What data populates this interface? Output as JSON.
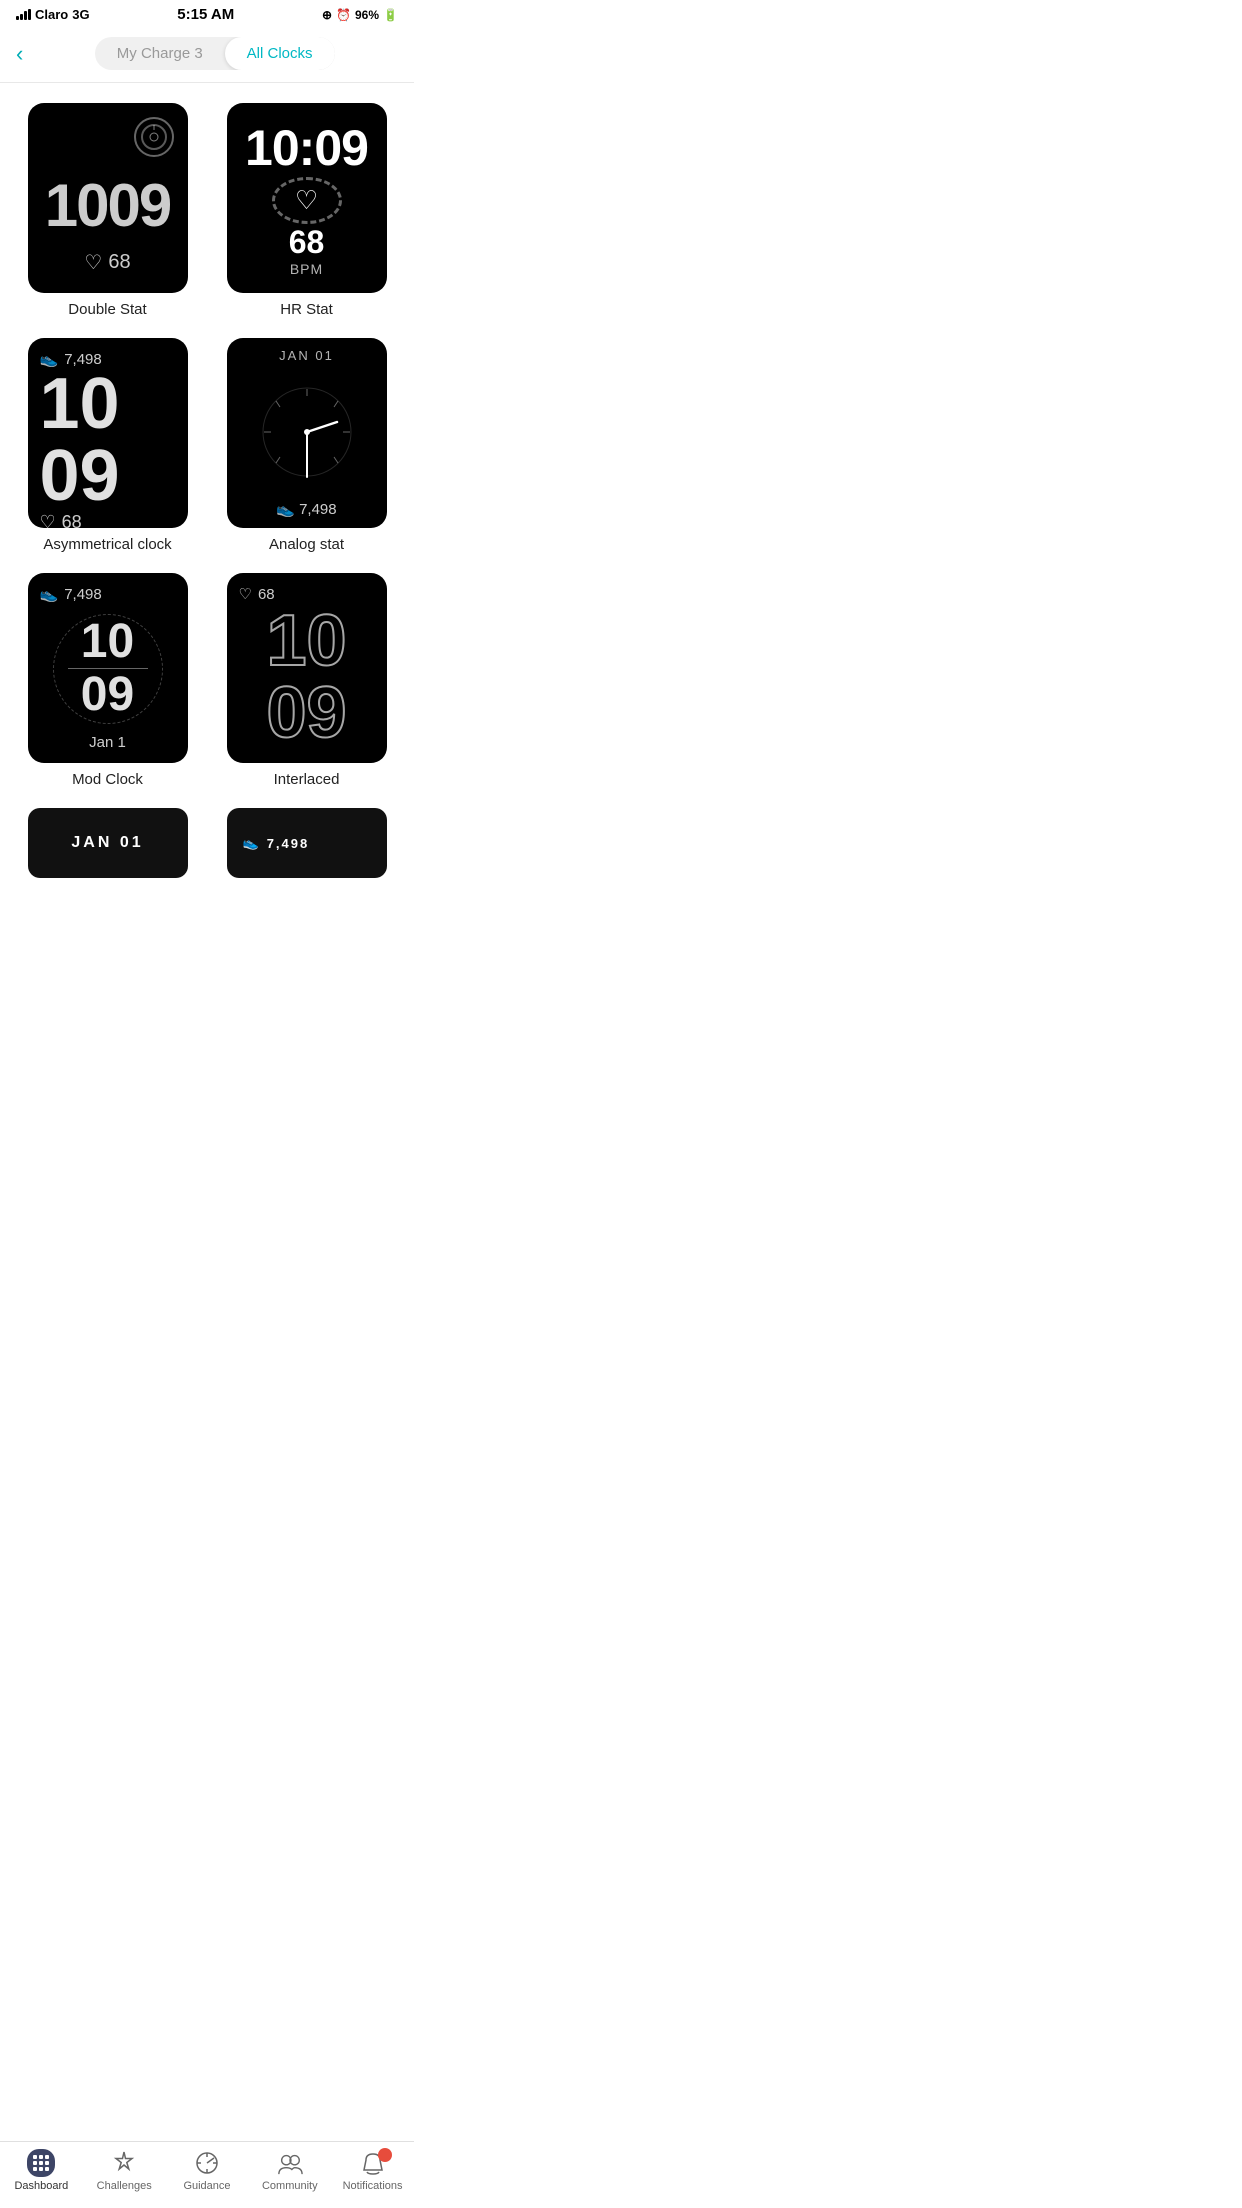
{
  "statusBar": {
    "carrier": "Claro",
    "network": "3G",
    "time": "5:15 AM",
    "battery": "96%"
  },
  "header": {
    "backLabel": "‹",
    "tab1": "My Charge 3",
    "tab2": "All Clocks",
    "activeTab": "All Clocks"
  },
  "clocks": [
    {
      "id": "double-stat",
      "name": "Double Stat",
      "time": "1009",
      "heartRate": "68"
    },
    {
      "id": "hr-stat",
      "name": "HR Stat",
      "time": "10:09",
      "heartRate": "68",
      "bpmLabel": "BPM"
    },
    {
      "id": "asymmetrical",
      "name": "Asymmetrical clock",
      "steps": "7,498",
      "hour": "10",
      "minute": "09",
      "heartRate": "68"
    },
    {
      "id": "analog-stat",
      "name": "Analog stat",
      "date": "JAN 01",
      "steps": "7,498"
    },
    {
      "id": "mod-clock",
      "name": "Mod Clock",
      "steps": "7,498",
      "hour": "10",
      "minute": "09",
      "date": "Jan 1"
    },
    {
      "id": "interlaced",
      "name": "Interlaced",
      "heartRate": "68",
      "hour": "10",
      "minute": "09"
    }
  ],
  "partialClocks": [
    {
      "id": "partial-1",
      "label": "JAN 01",
      "type": "date"
    },
    {
      "id": "partial-2",
      "label": "7,498",
      "type": "steps"
    }
  ],
  "bottomNav": {
    "items": [
      {
        "id": "dashboard",
        "label": "Dashboard",
        "active": true
      },
      {
        "id": "challenges",
        "label": "Challenges",
        "active": false
      },
      {
        "id": "guidance",
        "label": "Guidance",
        "active": false
      },
      {
        "id": "community",
        "label": "Community",
        "active": false
      },
      {
        "id": "notifications",
        "label": "Notifications",
        "active": false,
        "badge": true
      }
    ]
  }
}
